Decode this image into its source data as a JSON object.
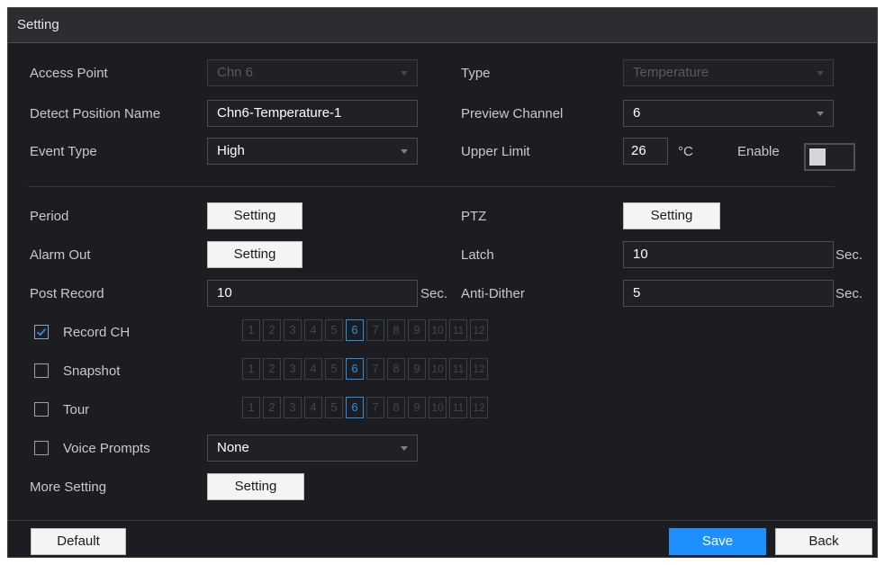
{
  "window": {
    "title": "Setting"
  },
  "left": {
    "access_point": {
      "label": "Access Point",
      "value": "Chn 6"
    },
    "detect_position_name": {
      "label": "Detect Position Name",
      "value": "Chn6-Temperature-1"
    },
    "event_type": {
      "label": "Event Type",
      "value": "High"
    },
    "period": {
      "label": "Period",
      "button": "Setting"
    },
    "alarm_out": {
      "label": "Alarm Out",
      "button": "Setting"
    },
    "post_record": {
      "label": "Post Record",
      "value": "10",
      "unit": "Sec."
    },
    "record_ch": {
      "label": "Record CH",
      "checked": true
    },
    "snapshot": {
      "label": "Snapshot",
      "checked": false
    },
    "tour": {
      "label": "Tour",
      "checked": false
    },
    "voice_prompts": {
      "label": "Voice Prompts",
      "checked": false,
      "value": "None"
    },
    "more_setting": {
      "label": "More Setting",
      "button": "Setting"
    }
  },
  "right": {
    "type": {
      "label": "Type",
      "value": "Temperature"
    },
    "preview_channel": {
      "label": "Preview Channel",
      "value": "6"
    },
    "upper_limit": {
      "label": "Upper Limit",
      "value": "26",
      "unit": "°C",
      "enable_label": "Enable",
      "enabled": false
    },
    "ptz": {
      "label": "PTZ",
      "button": "Setting"
    },
    "latch": {
      "label": "Latch",
      "value": "10",
      "unit": "Sec."
    },
    "anti_dither": {
      "label": "Anti-Dither",
      "value": "5",
      "unit": "Sec."
    }
  },
  "channels": [
    "1",
    "2",
    "3",
    "4",
    "5",
    "6",
    "7",
    "8",
    "9",
    "10",
    "11",
    "12"
  ],
  "selected_channel": "6",
  "footer": {
    "default": "Default",
    "save": "Save",
    "back": "Back"
  },
  "colors": {
    "accent": "#1e8fff",
    "panel_bg": "#1b1d21",
    "selected_chip": "#2b8ee8"
  }
}
